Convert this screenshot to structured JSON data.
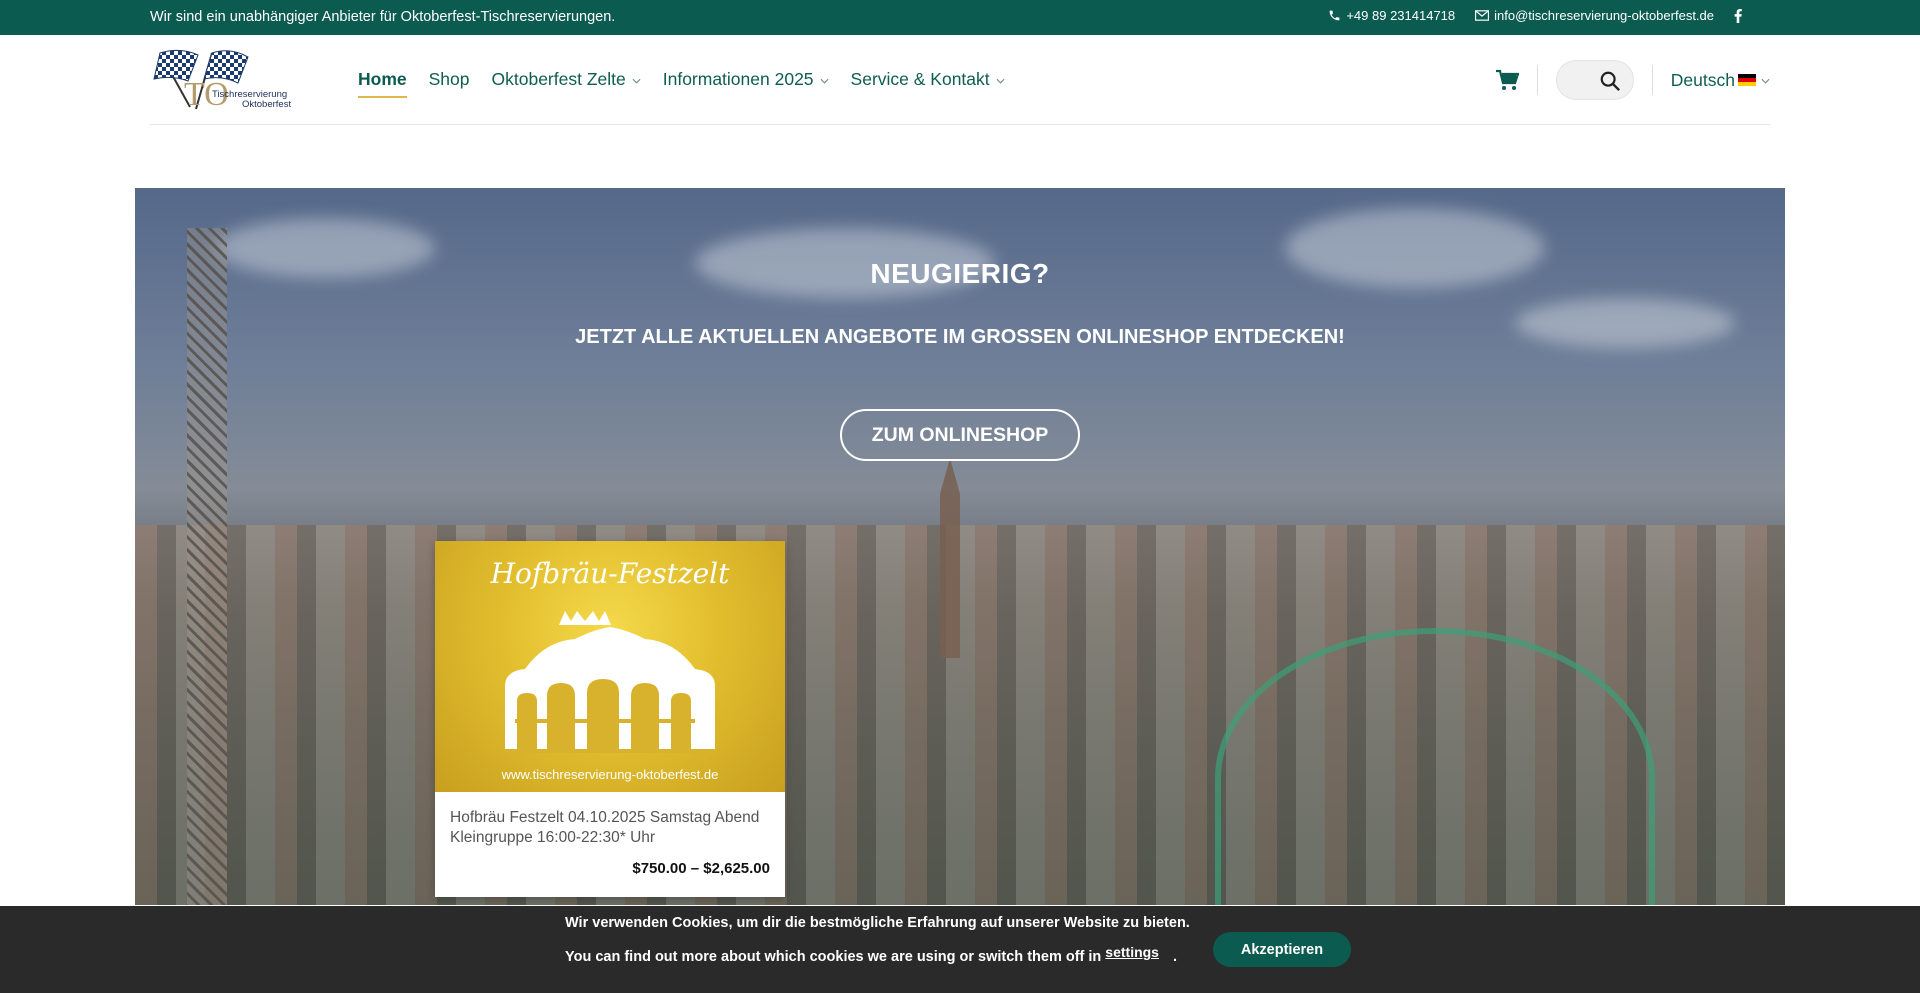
{
  "topbar": {
    "tagline": "Wir sind ein unabhängiger Anbieter für Oktoberfest-Tischreservierungen.",
    "phone": "+49 89 231414718",
    "email": "info@tischreservierung-oktoberfest.de",
    "phone_icon": "phone-icon",
    "email_icon": "envelope-icon",
    "social_icon": "facebook-icon"
  },
  "logo": {
    "line1": "Tischreservierung",
    "line2": "Oktoberfest"
  },
  "nav": {
    "items": [
      {
        "label": "Home",
        "active": true,
        "dropdown": false
      },
      {
        "label": "Shop",
        "active": false,
        "dropdown": false
      },
      {
        "label": "Oktoberfest Zelte",
        "active": false,
        "dropdown": true
      },
      {
        "label": "Informationen 2025",
        "active": false,
        "dropdown": true
      },
      {
        "label": "Service & Kontakt",
        "active": false,
        "dropdown": true
      }
    ]
  },
  "header": {
    "cart_icon": "cart-icon",
    "search_icon": "search-icon",
    "language": "Deutsch"
  },
  "hero": {
    "title": "NEUGIERIG?",
    "subtitle": "JETZT ALLE AKTUELLEN ANGEBOTE IM GROSSEN ONLINESHOP ENTDECKEN!",
    "button": "ZUM ONLINESHOP"
  },
  "product": {
    "image_title": "Hofbräu-Festzelt",
    "image_url": "www.tischreservierung-oktoberfest.de",
    "title": "Hofbräu Festzelt 04.10.2025 Samstag Abend Kleingruppe 16:00-22:30* Uhr",
    "price": "$750.00 – $2,625.00"
  },
  "cookie": {
    "line1": "Wir verwenden Cookies, um dir die bestmögliche Erfahrung auf unserer Website zu bieten.",
    "line2": "You can find out more about which cookies we are using or switch them off in",
    "settings_link": "settings",
    "period": ".",
    "accept": "Akzeptieren"
  },
  "colors": {
    "brand": "#0b5b51",
    "accent": "#e0b84a",
    "cookie_bg": "#2a2a2a"
  }
}
